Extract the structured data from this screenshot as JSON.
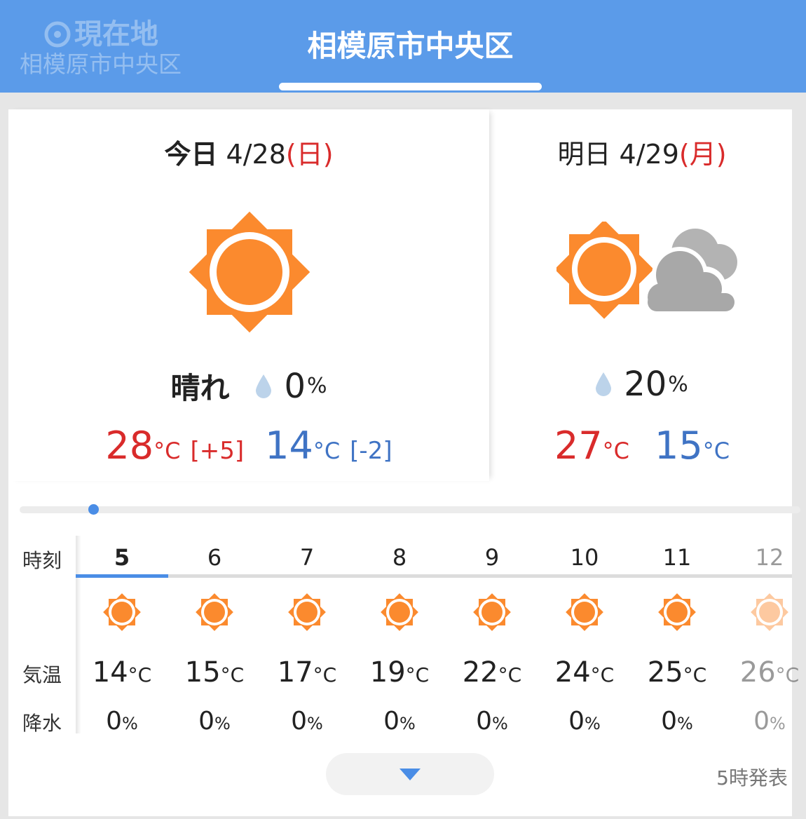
{
  "header": {
    "current_location_label": "現在地",
    "current_location_sub": "相模原市中央区",
    "active_tab": "相模原市中央区"
  },
  "today": {
    "label": "今日",
    "date": "4/28",
    "weekday": "(日)",
    "weather": "晴れ",
    "icon": "sun-icon",
    "rain": "0",
    "rain_unit": "%",
    "high": "28",
    "high_diff": "[+5]",
    "low": "14",
    "low_diff": "[-2]",
    "unit": "°C"
  },
  "tomorrow": {
    "label": "明日",
    "date": "4/29",
    "weekday": "(月)",
    "icon": "sun-cloud-icon",
    "rain": "20",
    "rain_unit": "%",
    "high": "27",
    "low": "15",
    "unit": "°C"
  },
  "hourly": {
    "labels": {
      "time": "時刻",
      "temp": "気温",
      "rain": "降水"
    },
    "selected_index": 0,
    "hours": [
      {
        "hour": "5",
        "temp": "14",
        "rain": "0",
        "icon": "sun-icon"
      },
      {
        "hour": "6",
        "temp": "15",
        "rain": "0",
        "icon": "sun-icon"
      },
      {
        "hour": "7",
        "temp": "17",
        "rain": "0",
        "icon": "sun-icon"
      },
      {
        "hour": "8",
        "temp": "19",
        "rain": "0",
        "icon": "sun-icon"
      },
      {
        "hour": "9",
        "temp": "22",
        "rain": "0",
        "icon": "sun-icon"
      },
      {
        "hour": "10",
        "temp": "24",
        "rain": "0",
        "icon": "sun-icon"
      },
      {
        "hour": "11",
        "temp": "25",
        "rain": "0",
        "icon": "sun-icon"
      },
      {
        "hour": "12",
        "temp": "26",
        "rain": "0",
        "icon": "sun-icon"
      }
    ],
    "temp_unit": "°C",
    "rain_unit": "%"
  },
  "footer": {
    "issued": "5時発表",
    "expand_icon": "triangle-down-icon"
  },
  "colors": {
    "header": "#5b9be9",
    "sun": "#fb8a2e",
    "high": "#d92b2b",
    "low": "#3f73c4",
    "accent": "#4a8de6"
  }
}
